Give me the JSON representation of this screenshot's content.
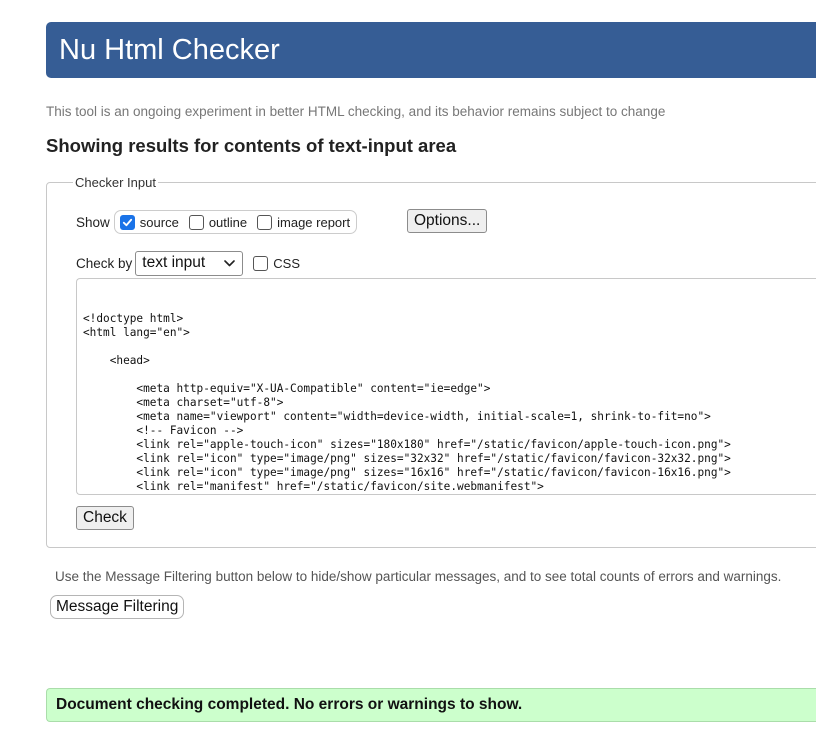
{
  "header": {
    "title": "Nu Html Checker"
  },
  "subtitle": "This tool is an ongoing experiment in better HTML checking, and its behavior remains subject to change",
  "results_heading": "Showing results for contents of text-input area",
  "checker_input": {
    "legend": "Checker Input",
    "show_label": "Show",
    "show_options": [
      {
        "label": "source",
        "checked": true
      },
      {
        "label": "outline",
        "checked": false
      },
      {
        "label": "image report",
        "checked": false
      }
    ],
    "options_button": "Options...",
    "check_by_label": "Check by",
    "check_by_value": "text input",
    "css_label": "CSS",
    "css_checked": false,
    "code_lines": [
      "<!doctype html>",
      "<html lang=\"en\">",
      "",
      "    <head>",
      "",
      "        <meta http-equiv=\"X-UA-Compatible\" content=\"ie=edge\">",
      "        <meta charset=\"utf-8\">",
      "        <meta name=\"viewport\" content=\"width=device-width, initial-scale=1, shrink-to-fit=no\">",
      "        <!-- Favicon -->",
      "        <link rel=\"apple-touch-icon\" sizes=\"180x180\" href=\"/static/favicon/apple-touch-icon.png\">",
      "        <link rel=\"icon\" type=\"image/png\" sizes=\"32x32\" href=\"/static/favicon/favicon-32x32.png\">",
      "        <link rel=\"icon\" type=\"image/png\" sizes=\"16x16\" href=\"/static/favicon/favicon-16x16.png\">",
      "        <link rel=\"manifest\" href=\"/static/favicon/site.webmanifest\">"
    ],
    "check_button": "Check"
  },
  "filter_note": "Use the Message Filtering button below to hide/show particular messages, and to see total counts of errors and warnings.",
  "filter_button": "Message Filtering",
  "success_message": "Document checking completed. No errors or warnings to show.",
  "colors": {
    "header_bg": "#365d95",
    "checkbox_checked": "#1a73e8",
    "success_bg": "#ccffcc"
  }
}
